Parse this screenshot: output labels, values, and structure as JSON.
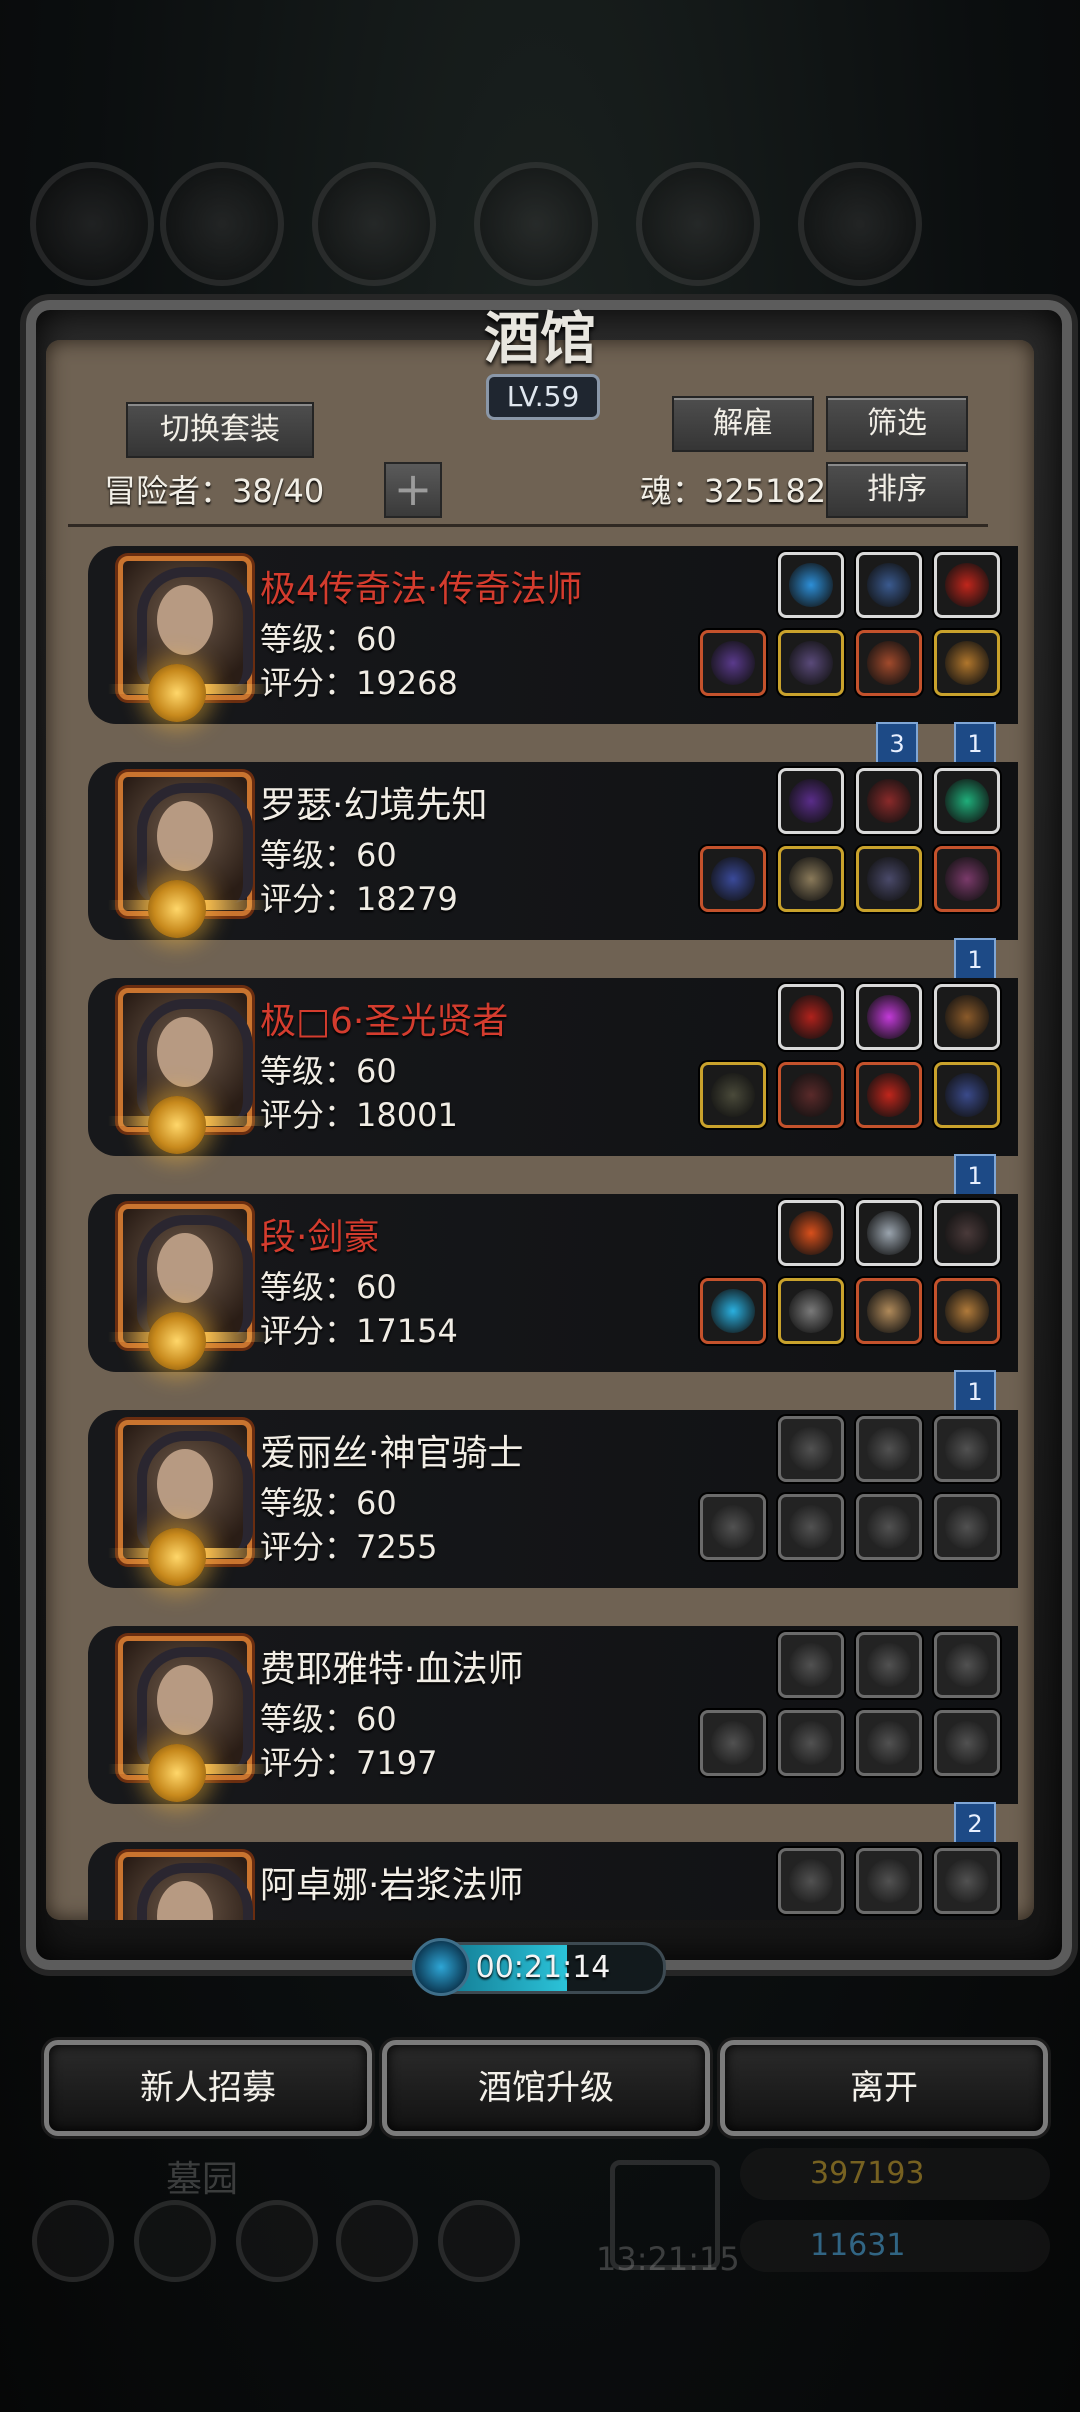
{
  "top_resources": [
    "",
    "",
    "",
    "",
    "",
    ""
  ],
  "tavern": {
    "title": "酒馆",
    "level": "LV.59",
    "switch_outfit": "切换套装",
    "dismiss": "解雇",
    "filter": "筛选",
    "sort": "排序",
    "adventurer_label": "冒险者：38/40",
    "soul_label": "魂：325182",
    "plus": "+"
  },
  "heroes": [
    {
      "name": "极4传奇法·传奇法师",
      "name_color": "red",
      "level": "等级：60",
      "score": "评分：19268",
      "top_slots": [
        [
          "w",
          "#2d8fd8"
        ],
        [
          "w",
          "#3a5a8f"
        ],
        [
          "w",
          "#c0261c"
        ]
      ],
      "bottom_slots": [
        [
          "r",
          "#5a3a8c"
        ],
        [
          "y",
          "#5a4a7a"
        ],
        [
          "r",
          "#a14a2c"
        ],
        [
          "y",
          "#b0762c"
        ]
      ],
      "flags": [
        {
          "text": "3",
          "pos": 0
        },
        {
          "text": "1",
          "pos": 2
        }
      ]
    },
    {
      "name": "罗瑟·幻境先知",
      "name_color": "white",
      "level": "等级：60",
      "score": "评分：18279",
      "top_slots": [
        [
          "w",
          "#5a2d8a"
        ],
        [
          "w",
          "#8a2a2a"
        ],
        [
          "w",
          "#1fae7a"
        ]
      ],
      "bottom_slots": [
        [
          "r",
          "#3a4a9a"
        ],
        [
          "y",
          "#8a7a5a"
        ],
        [
          "y",
          "#4a4a6a"
        ],
        [
          "r",
          "#7a3a6a"
        ]
      ],
      "flags": [
        {
          "text": "1",
          "pos": 2
        }
      ]
    },
    {
      "name": "极□6·圣光贤者",
      "name_color": "red",
      "level": "等级：60",
      "score": "评分：18001",
      "top_slots": [
        [
          "w",
          "#b0221c"
        ],
        [
          "w",
          "#c23ad8"
        ],
        [
          "w",
          "#8a5a2a"
        ]
      ],
      "bottom_slots": [
        [
          "y",
          "#4a4a3a"
        ],
        [
          "r",
          "#5a2a2a"
        ],
        [
          "r",
          "#c0261c"
        ],
        [
          "y",
          "#3a4a8a"
        ]
      ],
      "flags": [
        {
          "text": "1",
          "pos": 2
        }
      ]
    },
    {
      "name": "段·剑豪",
      "name_color": "red",
      "level": "等级：60",
      "score": "评分：17154",
      "top_slots": [
        [
          "w",
          "#d8501c"
        ],
        [
          "w",
          "#9aa4ae"
        ],
        [
          "w",
          "#4a3a3a"
        ]
      ],
      "bottom_slots": [
        [
          "r",
          "#2ab0e0"
        ],
        [
          "y",
          "#7a7a7a"
        ],
        [
          "r",
          "#b08a5a"
        ],
        [
          "r",
          "#b07a3a"
        ]
      ],
      "flags": [
        {
          "text": "1",
          "pos": 2
        }
      ]
    },
    {
      "name": "爱丽丝·神官骑士",
      "name_color": "white",
      "level": "等级：60",
      "score": "评分：7255",
      "top_slots": [
        [
          "e",
          "#777"
        ],
        [
          "e",
          "#777"
        ],
        [
          "e",
          "#777"
        ]
      ],
      "bottom_slots": [
        [
          "e",
          "#777"
        ],
        [
          "e",
          "#777"
        ],
        [
          "e",
          "#777"
        ],
        [
          "e",
          "#777"
        ]
      ],
      "flags": []
    },
    {
      "name": "费耶雅特·血法师",
      "name_color": "white",
      "level": "等级：60",
      "score": "评分：7197",
      "top_slots": [
        [
          "e",
          "#777"
        ],
        [
          "e",
          "#777"
        ],
        [
          "e",
          "#777"
        ]
      ],
      "bottom_slots": [
        [
          "e",
          "#777"
        ],
        [
          "e",
          "#777"
        ],
        [
          "e",
          "#777"
        ],
        [
          "e",
          "#777"
        ]
      ],
      "flags": [
        {
          "text": "2",
          "pos": 1
        }
      ]
    },
    {
      "name": "阿卓娜·岩浆法师",
      "name_color": "white",
      "level": "",
      "score": "",
      "top_slots": [
        [
          "e",
          "#777"
        ],
        [
          "e",
          "#777"
        ],
        [
          "e",
          "#777"
        ]
      ],
      "bottom_slots": [],
      "flags": []
    }
  ],
  "timer": {
    "text": "00:21:14",
    "progress": 0.6
  },
  "buttons": {
    "recruit": "新人招募",
    "upgrade": "酒馆升级",
    "leave": "离开"
  },
  "background_hud": {
    "area_name": "墓园",
    "gift_timer": "13:21:15",
    "gold": "397193",
    "gems": "11631"
  },
  "colors": {
    "name_red": "#d43c2e",
    "frame_parchment": "#6f6253",
    "accent_blue": "#2bc3d9"
  }
}
